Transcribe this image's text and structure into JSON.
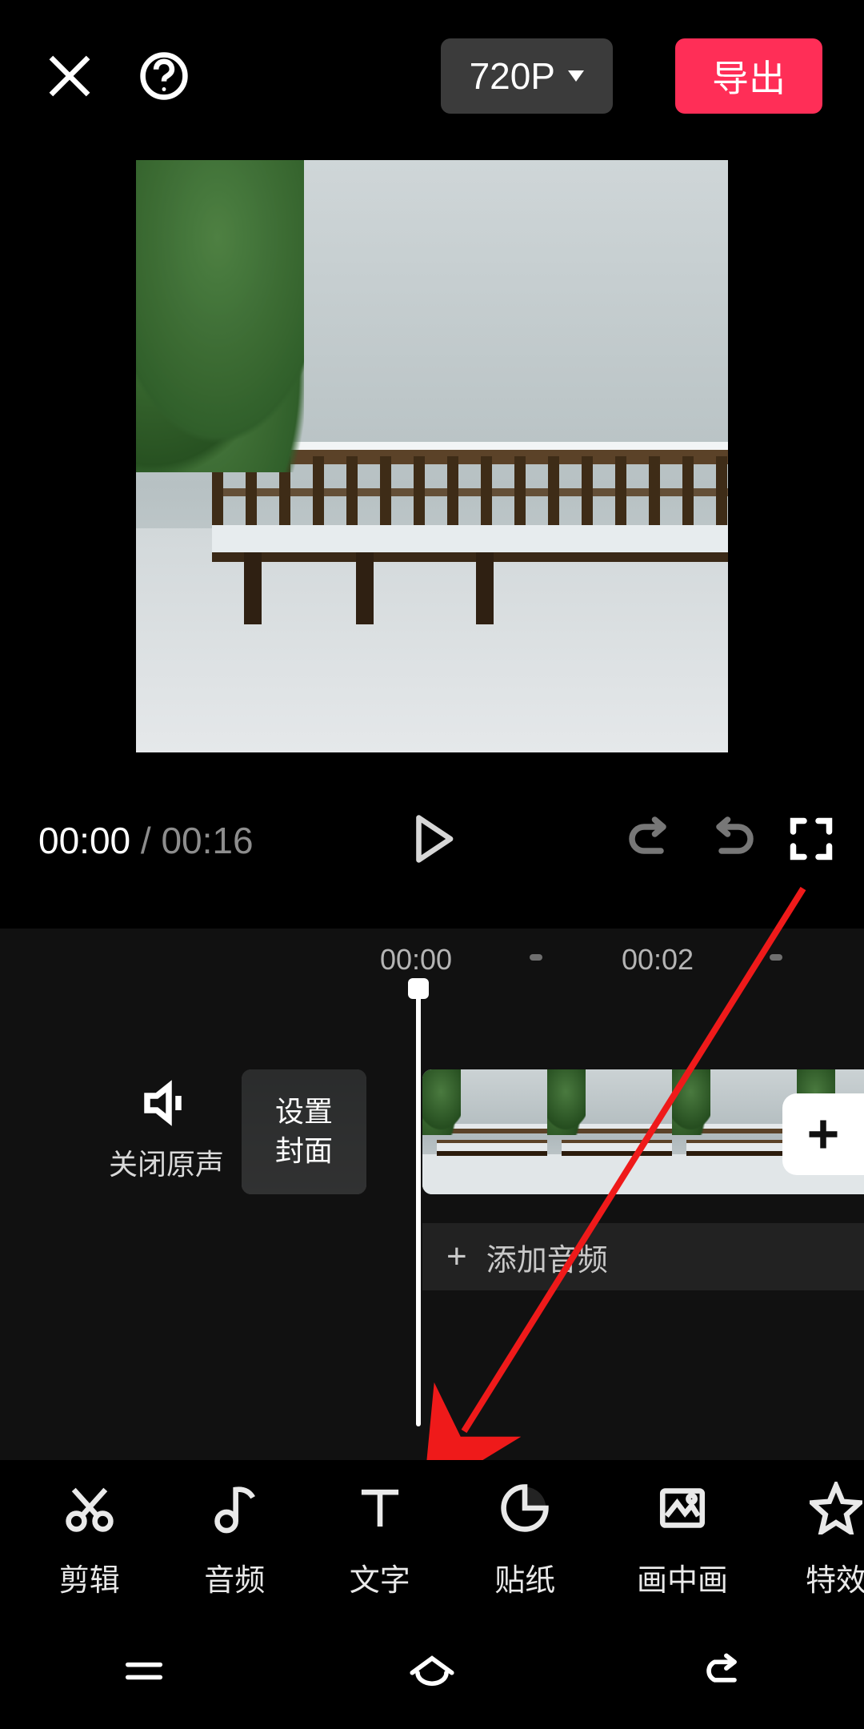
{
  "header": {
    "resolution_label": "720P",
    "export_label": "导出"
  },
  "player": {
    "current_time": "00:00",
    "total_time": "00:16"
  },
  "ruler": {
    "ticks": [
      "00:00",
      "00:02"
    ]
  },
  "timeline": {
    "mute_label": "关闭原声",
    "cover_button_line1": "设置",
    "cover_button_line2": "封面",
    "add_audio_label": "添加音频"
  },
  "toolbar": {
    "items": [
      {
        "icon": "scissors-icon",
        "label": "剪辑"
      },
      {
        "icon": "music-note-icon",
        "label": "音频"
      },
      {
        "icon": "text-icon",
        "label": "文字"
      },
      {
        "icon": "sticker-icon",
        "label": "贴纸"
      },
      {
        "icon": "picture-in-picture-icon",
        "label": "画中画"
      },
      {
        "icon": "effects-icon",
        "label": "特效"
      }
    ]
  },
  "colors": {
    "accent": "#ff2e57",
    "panel": "#3b3b3b"
  }
}
